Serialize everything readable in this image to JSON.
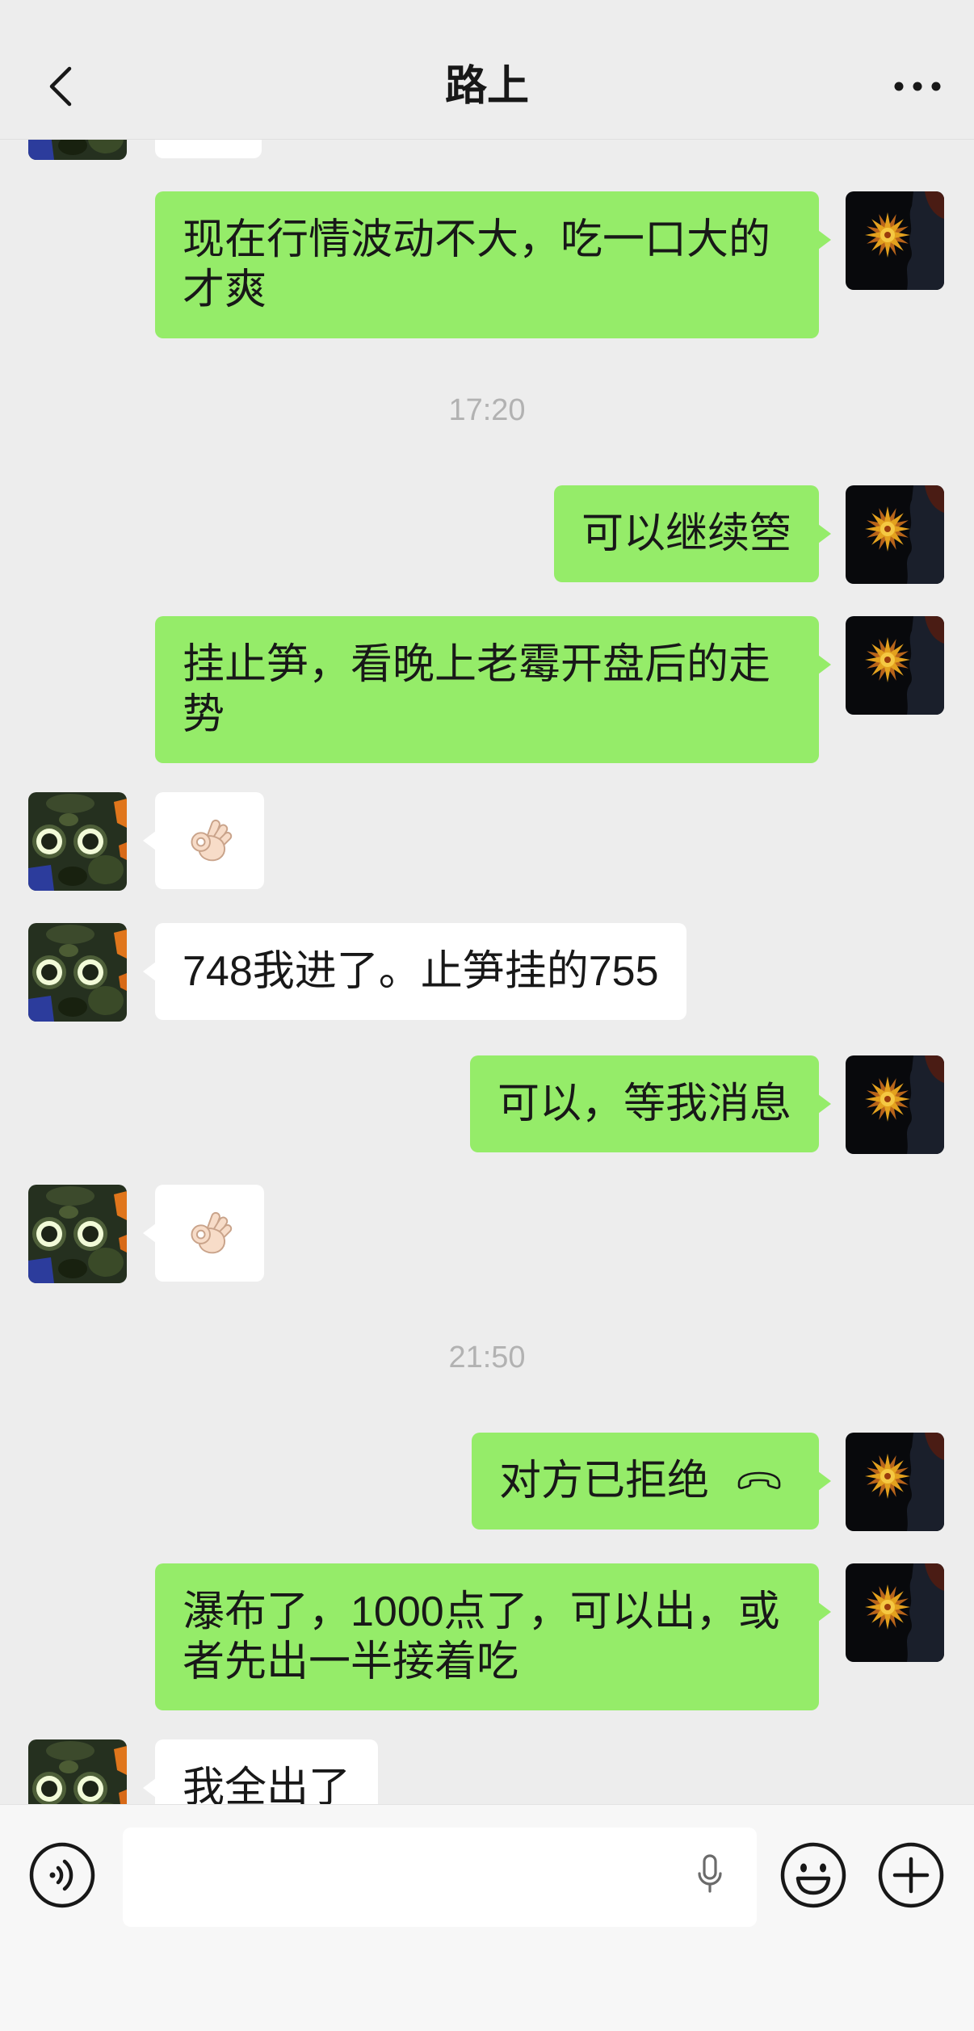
{
  "header": {
    "title": "路上",
    "back_icon": "chevron-left-icon",
    "more_icon": "more-dots-icon"
  },
  "messages": [
    {
      "outgoing": true,
      "text": "现在行情波动不大，吃一口大的才爽"
    },
    {
      "outgoing": true,
      "text": "可以继续箜"
    },
    {
      "outgoing": true,
      "text": "挂止笋，看晚上老霉开盘后的走势"
    },
    {
      "outgoing": false,
      "icon": "ok-hand-emoji-icon"
    },
    {
      "outgoing": false,
      "text": "748我进了。止笋挂的755"
    },
    {
      "outgoing": true,
      "text": "可以，等我消息"
    },
    {
      "outgoing": false,
      "icon": "ok-hand-emoji-icon"
    },
    {
      "outgoing": true,
      "text": "对方已拒绝",
      "icon": "phone-hangup-icon"
    },
    {
      "outgoing": true,
      "text": "瀑布了，1000点了，可以出，或者先出一半接着吃"
    },
    {
      "outgoing": false,
      "text": "我全出了"
    }
  ],
  "timestamps": [
    "17:20",
    "21:50"
  ],
  "footer": {
    "voice_icon": "voice-input-icon",
    "input_value": "",
    "mic_icon": "microphone-icon",
    "emoji_icon": "emoji-face-icon",
    "plus_icon": "plus-circle-icon"
  },
  "colors": {
    "background": "#EDEDED",
    "outgoing_bubble": "#95EC69",
    "incoming_bubble": "#FFFFFF",
    "timestamp": "#B2B2B2",
    "footer_background": "#F7F7F7"
  }
}
